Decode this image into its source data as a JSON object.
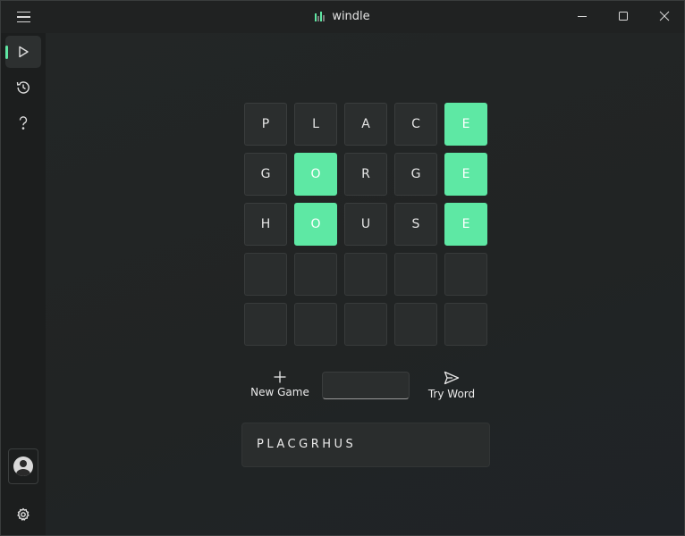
{
  "app": {
    "title": "windle",
    "logo_icon": "bar-chart-logo-icon",
    "accent": "#5ee8a4"
  },
  "titlebar": {
    "menu_icon": "hamburger-icon",
    "controls": [
      "minimize-icon",
      "maximize-icon",
      "close-icon"
    ]
  },
  "sidebar": {
    "items": [
      {
        "name": "play",
        "icon": "play-icon",
        "active": true
      },
      {
        "name": "history",
        "icon": "history-icon",
        "active": false
      },
      {
        "name": "help",
        "icon": "question-icon",
        "active": false
      }
    ],
    "footer": [
      "avatar",
      "gear-icon"
    ]
  },
  "board": {
    "rows": [
      [
        {
          "letter": "P",
          "state": "miss"
        },
        {
          "letter": "L",
          "state": "miss"
        },
        {
          "letter": "A",
          "state": "miss"
        },
        {
          "letter": "C",
          "state": "miss"
        },
        {
          "letter": "E",
          "state": "hit"
        }
      ],
      [
        {
          "letter": "G",
          "state": "miss"
        },
        {
          "letter": "O",
          "state": "hit"
        },
        {
          "letter": "R",
          "state": "miss"
        },
        {
          "letter": "G",
          "state": "miss"
        },
        {
          "letter": "E",
          "state": "hit"
        }
      ],
      [
        {
          "letter": "H",
          "state": "miss"
        },
        {
          "letter": "O",
          "state": "hit"
        },
        {
          "letter": "U",
          "state": "miss"
        },
        {
          "letter": "S",
          "state": "miss"
        },
        {
          "letter": "E",
          "state": "hit"
        }
      ],
      [
        {
          "letter": "",
          "state": "empty"
        },
        {
          "letter": "",
          "state": "empty"
        },
        {
          "letter": "",
          "state": "empty"
        },
        {
          "letter": "",
          "state": "empty"
        },
        {
          "letter": "",
          "state": "empty"
        }
      ],
      [
        {
          "letter": "",
          "state": "empty"
        },
        {
          "letter": "",
          "state": "empty"
        },
        {
          "letter": "",
          "state": "empty"
        },
        {
          "letter": "",
          "state": "empty"
        },
        {
          "letter": "",
          "state": "empty"
        }
      ]
    ]
  },
  "controls": {
    "new_game_label": "New Game",
    "new_game_icon": "plus-icon",
    "word_input_value": "",
    "try_word_label": "Try Word",
    "try_word_icon": "send-icon"
  },
  "used_letters": "PLACGRHUS"
}
